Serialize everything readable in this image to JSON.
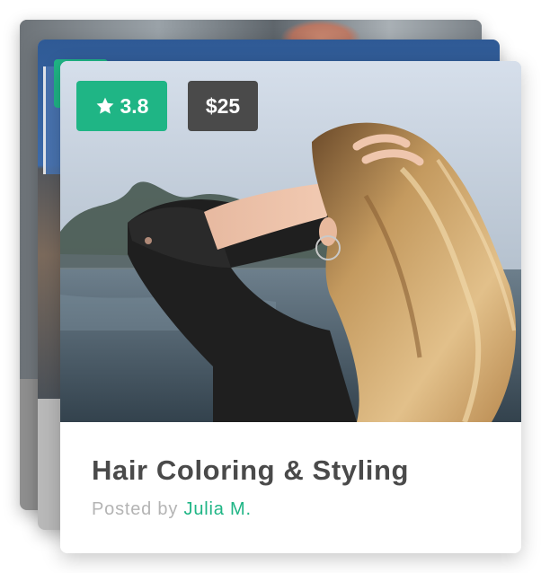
{
  "card": {
    "rating": "3.8",
    "price": "$25",
    "title": "Hair Coloring & Styling",
    "posted_by_label": "Posted by",
    "author": "Julia M.",
    "image_subject": "woman with wavy blonde hair by a lake"
  },
  "icons": {
    "rating": "star-icon"
  },
  "colors": {
    "accent": "#1fb585",
    "price_badge": "#4a4a4a",
    "title_text": "#4a4a4a",
    "muted_text": "#b4b4b4"
  }
}
